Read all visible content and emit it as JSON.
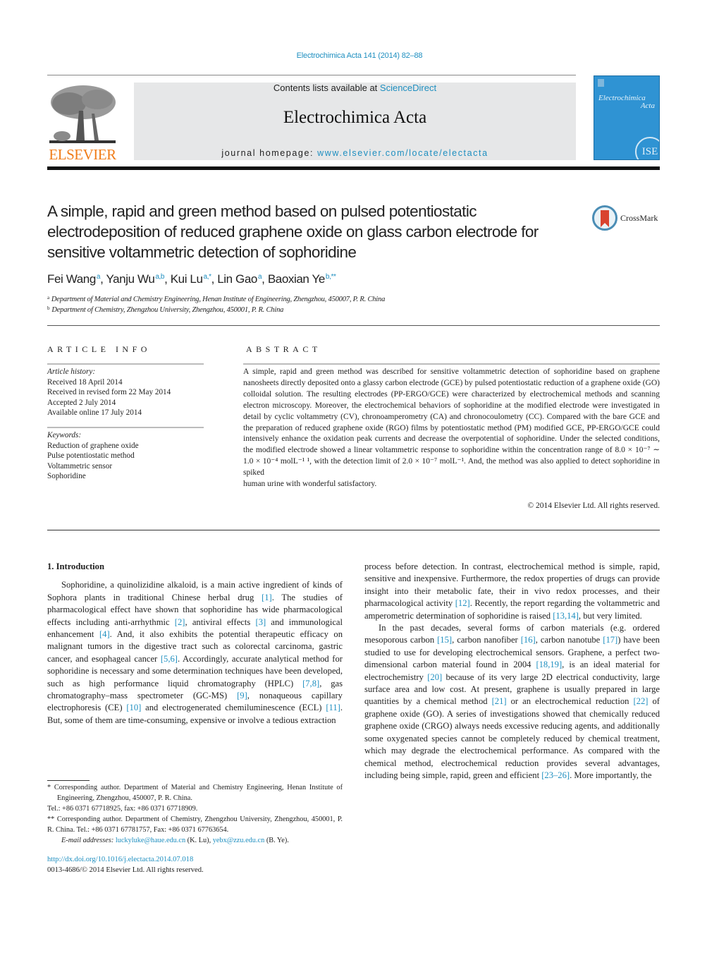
{
  "header": {
    "journal_ref": "Electrochimica Acta 141 (2014) 82–88",
    "contents_prefix": "Contents lists available at ",
    "contents_link": "ScienceDirect",
    "journal_name": "Electrochimica Acta",
    "homepage_prefix": "journal homepage: ",
    "homepage_link": "www.elsevier.com/locate/electacta",
    "publisher_logo": "ELSEVIER",
    "cover": {
      "title_line1": "Electrochimica",
      "title_line2": "Acta",
      "seal": "ISE",
      "color": "#2f93d3"
    },
    "crossmark_label": "CrossMark"
  },
  "article": {
    "title": "A simple, rapid and green method based on pulsed potentiostatic electrodeposition of reduced graphene oxide on glass carbon electrode for sensitive voltammetric detection of sophoridine",
    "authors": [
      {
        "name": "Fei Wang",
        "marks": "a"
      },
      {
        "name": "Yanju Wu",
        "marks": "a,b"
      },
      {
        "name": "Kui Lu",
        "marks": "a,*"
      },
      {
        "name": "Lin Gao",
        "marks": "a"
      },
      {
        "name": "Baoxian Ye",
        "marks": "b,**"
      }
    ],
    "affiliations": [
      {
        "mark": "a",
        "text": "Department of Material and Chemistry Engineering, Henan Institute of Engineering, Zhengzhou, 450007, P. R. China"
      },
      {
        "mark": "b",
        "text": "Department of Chemistry, Zhengzhou University, Zhengzhou, 450001, P. R. China"
      }
    ]
  },
  "article_info": {
    "heading": "ARTICLE INFO",
    "history_label": "Article history:",
    "history": [
      "Received 18 April 2014",
      "Received in revised form 22 May 2014",
      "Accepted 2 July 2014",
      "Available online 17 July 2014"
    ],
    "keywords_label": "Keywords:",
    "keywords": [
      "Reduction of graphene oxide",
      "Pulse potentiostatic method",
      "Voltammetric sensor",
      "Sophoridine"
    ]
  },
  "abstract": {
    "heading": "ABSTRACT",
    "text_main": "A simple, rapid and green method was described for sensitive voltammetric detection of sophoridine based on graphene nanosheets directly deposited onto a glassy carbon electrode (GCE) by pulsed potentiostatic reduction of a graphene oxide (GO) colloidal solution. The resulting electrodes (PP-ERGO/GCE) were characterized by electrochemical methods and scanning electron microscopy. Moreover, the electrochemical behaviors of sophoridine at the modified electrode were investigated in detail by cyclic voltammetry (CV), chronoamperometry (CA) and chronocoulometry (CC). Compared with the bare GCE and the preparation of reduced graphene oxide (RGO) films by potentiostatic method (PM) modified GCE, PP-ERGO/GCE could intensively enhance the oxidation peak currents and decrease the overpotential of sophoridine. Under the selected conditions, the modified electrode showed a linear voltammetric response to sophoridine within the concentration range of 8.0 × 10⁻⁷ ∼ 1.0 × 10⁻⁴ molL⁻¹ ¹, with the detection limit of 2.0 × 10⁻⁷ molL⁻¹. And, the method was also applied to detect sophoridine in spiked",
    "text_last": "human urine with wonderful satisfactory.",
    "copyright": "© 2014 Elsevier Ltd. All rights reserved."
  },
  "body": {
    "section_heading": "1.  Introduction",
    "left_para1": [
      {
        "t": "Sophoridine, a quinolizidine alkaloid, is a main active ingredient of kinds of Sophora plants in traditional Chinese herbal drug "
      },
      {
        "r": "[1]"
      },
      {
        "t": ". The studies of pharmacological effect have shown that sophoridine has wide pharmacological effects including anti-arrhythmic "
      },
      {
        "r": "[2]"
      },
      {
        "t": ", antiviral effects "
      },
      {
        "r": "[3]"
      },
      {
        "t": " and immunological enhancement "
      },
      {
        "r": "[4]"
      },
      {
        "t": ". And, it also exhibits the potential therapeutic efficacy on malignant tumors in the digestive tract such as colorectal carcinoma, gastric cancer, and esophageal cancer "
      },
      {
        "r": "[5,6]"
      },
      {
        "t": ". Accordingly, accurate analytical method for sophoridine is necessary and some determination techniques have been developed, such as high performance liquid chromatography (HPLC) "
      },
      {
        "r": "[7,8]"
      },
      {
        "t": ", gas chromatography–mass spectrometer (GC-MS) "
      },
      {
        "r": "[9]"
      },
      {
        "t": ", nonaqueous capillary electrophoresis (CE) "
      },
      {
        "r": "[10]"
      },
      {
        "t": " and electrogenerated chemiluminescence (ECL) "
      },
      {
        "r": "[11]"
      },
      {
        "t": ". But, some of them are time-consuming, expensive or involve a tedious extraction"
      }
    ],
    "right_para1": [
      {
        "t": "process before detection. In contrast, electrochemical method is simple, rapid, sensitive and inexpensive. Furthermore, the redox properties of drugs can provide insight into their metabolic fate, their in vivo redox processes, and their pharmacological activity "
      },
      {
        "r": "[12]"
      },
      {
        "t": ". Recently, the report regarding the voltammetric and amperometric determination of sophoridine is raised "
      },
      {
        "r": "[13,14]"
      },
      {
        "t": ", but very limited."
      }
    ],
    "right_para2": [
      {
        "t": "In the past decades, several forms of carbon materials (e.g. ordered mesoporous carbon "
      },
      {
        "r": "[15]"
      },
      {
        "t": ", carbon nanofiber "
      },
      {
        "r": "[16]"
      },
      {
        "t": ", carbon nanotube "
      },
      {
        "r": "[17]"
      },
      {
        "t": ") have been studied to use for developing electrochemical sensors. Graphene, a perfect two-dimensional carbon material found in 2004 "
      },
      {
        "r": "[18,19]"
      },
      {
        "t": ", is an ideal material for electrochemistry "
      },
      {
        "r": "[20]"
      },
      {
        "t": " because of its very large 2D electrical conductivity, large surface area and low cost. At present, graphene is usually prepared in large quantities by a chemical method "
      },
      {
        "r": "[21]"
      },
      {
        "t": " or an electrochemical reduction "
      },
      {
        "r": "[22]"
      },
      {
        "t": " of graphene oxide (GO). A series of investigations showed that chemically reduced graphene oxide (CRGO) always needs excessive reducing agents, and additionally some oxygenated species cannot be completely reduced by chemical treatment, which may degrade the electrochemical performance. As compared with the chemical method, electrochemical reduction provides several advantages, including being simple, rapid, green and efficient "
      },
      {
        "r": "[23–26]"
      },
      {
        "t": ". More importantly, the"
      }
    ]
  },
  "footnotes": {
    "fn1_line1": "* Corresponding author. Department of Material and Chemistry Engineering, Henan Institute of Engineering, Zhengzhou, 450007, P. R. China.",
    "fn1_line2": "Tel.: +86 0371 67718925, fax: +86 0371 67718909.",
    "fn2": "** Corresponding author. Department of Chemistry, Zhengzhou University, Zhengzhou, 450001, P. R. China. Tel.: +86 0371 67781757, Fax: +86 0371 67763654.",
    "email_label": "E-mail addresses: ",
    "email1": "luckyluke@haue.edu.cn",
    "email1_who": " (K. Lu), ",
    "email2": "yebx@zzu.edu.cn",
    "email2_who": " (B. Ye)."
  },
  "doi": {
    "link": "http://dx.doi.org/10.1016/j.electacta.2014.07.018",
    "issn_line": "0013-4686/© 2014 Elsevier Ltd. All rights reserved."
  },
  "colors": {
    "link": "#1f8fc0",
    "elsevier_orange": "#f07d1a",
    "masthead_bg": "#e6e7e8",
    "crossmark_red": "#d9432f"
  }
}
